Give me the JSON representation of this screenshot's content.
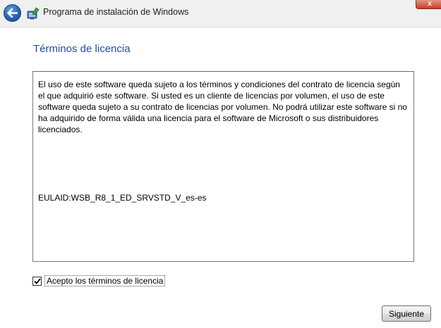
{
  "window": {
    "title": "Programa de instalación de Windows",
    "close_label": "x"
  },
  "icons": {
    "back": "back-arrow-icon",
    "app": "windows-setup-icon",
    "close": "close-icon",
    "checkmark": "checkmark-icon"
  },
  "page": {
    "title": "Términos de licencia"
  },
  "license": {
    "body": "El uso de este software queda sujeto a los términos y condiciones del contrato de licencia según el que adquirió este software. Si usted es un cliente de licencias por volumen, el uso de este software queda sujeto a su contrato de licencias por volumen. No podrá utilizar este software si no ha adquirido de forma válida una licencia para el software de Microsoft o sus distribuidores licenciados.",
    "eula_id": "EULAID:WSB_R8_1_ED_SRVSTD_V_es-es"
  },
  "accept": {
    "label": "Acepto los términos de licencia",
    "checked": true
  },
  "buttons": {
    "next_label": "Siguiente"
  },
  "colors": {
    "title_accent": "#1f4e9a",
    "back_button": "#2a63b0",
    "close_button": "#c9402a",
    "titlebar_bg": "#f0f0f0"
  }
}
